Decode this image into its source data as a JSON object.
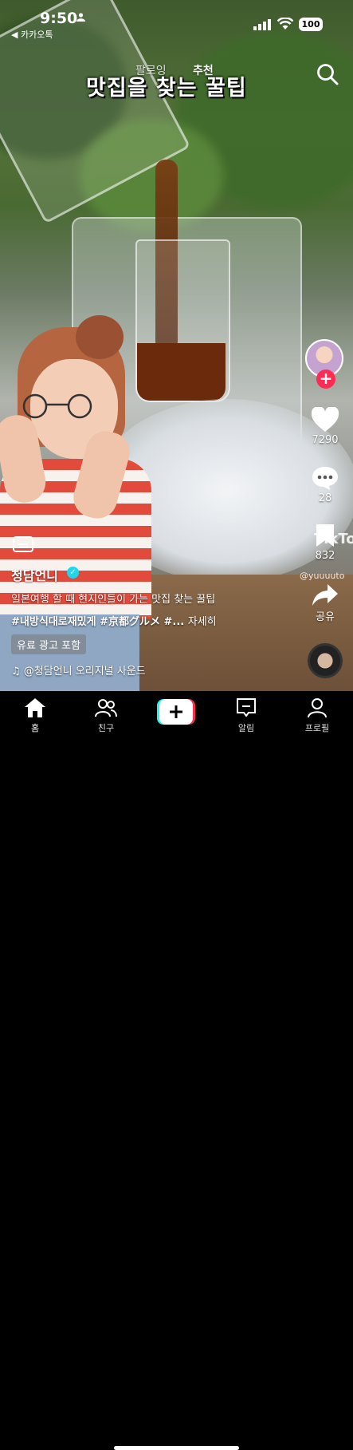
{
  "status_bar": {
    "time": "9:50",
    "back_app": "◀ 카카오톡",
    "battery": "100"
  },
  "feed_tabs": {
    "following": "팔로잉",
    "recommended": "추천"
  },
  "video_title": "맛집을 찾는 꿀팁",
  "creator": {
    "username": "청담언니",
    "description": "일본여행 할 때 현지인들이 가는 맛집 찾는 꿀팁",
    "hashtags": "#내방식대로재밌게 #京都グルメ #...",
    "more_label": "자세히",
    "ad_label": "유료 광고 포함",
    "sound": "@청담언니 오리지널 사운드"
  },
  "actions": {
    "likes": "7290",
    "comments": "28",
    "saves": "832",
    "share_label": "공유"
  },
  "watermark": {
    "brand": "TikTo",
    "handle": "@yuuuuto"
  },
  "nav": {
    "home": "홈",
    "friends": "친구",
    "inbox": "알림",
    "profile": "프로필"
  },
  "icons": {
    "search": "search-icon",
    "like": "heart-icon",
    "comment": "comment-icon",
    "save": "bookmark-icon",
    "share": "share-arrow-icon"
  },
  "colors": {
    "accent": "#fe2c55",
    "verified": "#20d5ec",
    "create_left": "#25f4ee",
    "create_right": "#fe2c55"
  }
}
